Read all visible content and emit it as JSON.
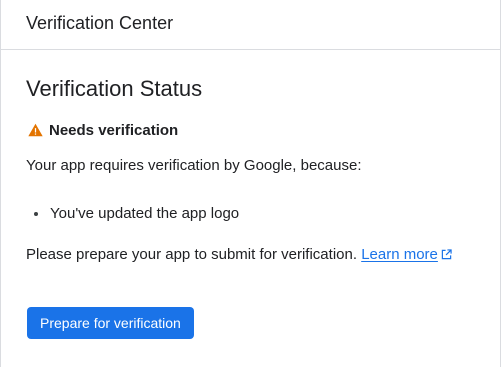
{
  "header": {
    "title": "Verification Center"
  },
  "status": {
    "title": "Verification Status",
    "badge_icon": "warning-triangle-icon",
    "badge_color": "#e37400",
    "badge_text": "Needs verification",
    "description": "Your app requires verification by Google, because:",
    "reasons": [
      "You've updated the app logo"
    ],
    "prepare_text": "Please prepare your app to submit for verification.",
    "learn_more_label": "Learn more",
    "learn_more_icon": "external-link-icon"
  },
  "actions": {
    "prepare_button_label": "Prepare for verification",
    "accent_color": "#1a73e8"
  }
}
